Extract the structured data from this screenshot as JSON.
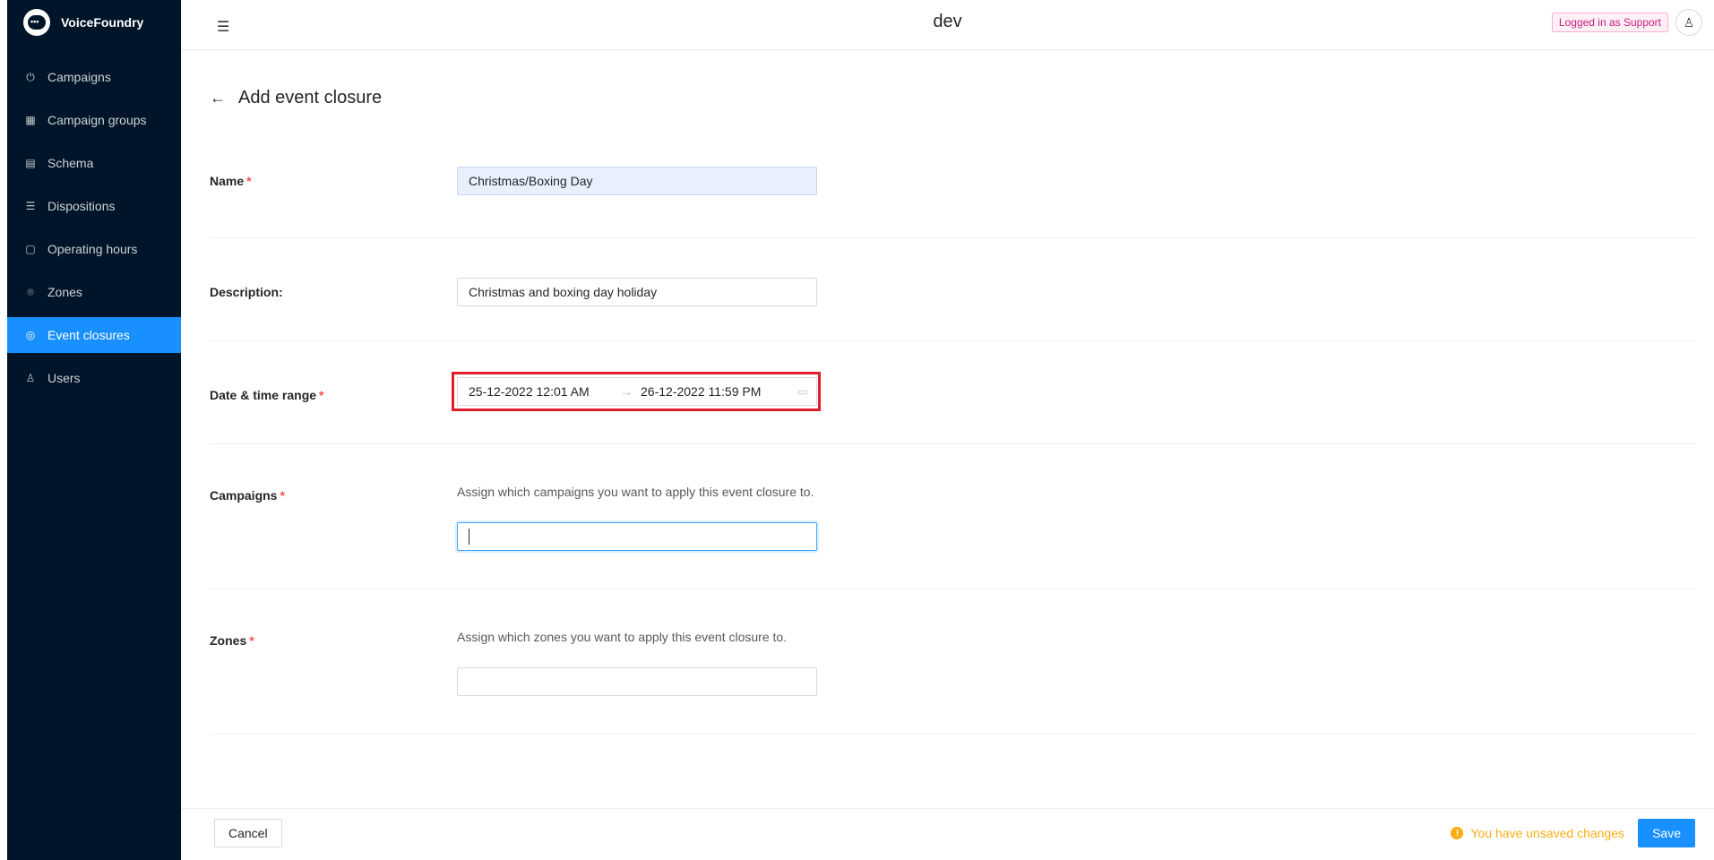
{
  "brand": {
    "name": "VoiceFoundry"
  },
  "sidebar": {
    "items": [
      {
        "label": "Campaigns",
        "icon": "power-icon"
      },
      {
        "label": "Campaign groups",
        "icon": "group-icon"
      },
      {
        "label": "Schema",
        "icon": "table-icon"
      },
      {
        "label": "Dispositions",
        "icon": "list-icon"
      },
      {
        "label": "Operating hours",
        "icon": "calendar-icon"
      },
      {
        "label": "Zones",
        "icon": "location-icon"
      },
      {
        "label": "Event closures",
        "icon": "target-icon",
        "active": true
      },
      {
        "label": "Users",
        "icon": "user-icon"
      }
    ]
  },
  "header": {
    "title": "dev",
    "support_tag": "Logged in as Support"
  },
  "page": {
    "title": "Add event closure"
  },
  "form": {
    "name": {
      "label": "Name",
      "value": "Christmas/Boxing Day"
    },
    "description": {
      "label": "Description",
      "value": "Christmas and boxing day holiday"
    },
    "date_range": {
      "label": "Date & time range",
      "start": "25-12-2022 12:01 AM",
      "end": "26-12-2022 11:59 PM"
    },
    "campaigns": {
      "label": "Campaigns",
      "help": "Assign which campaigns you want to apply this event closure to.",
      "value": ""
    },
    "zones": {
      "label": "Zones",
      "help": "Assign which zones you want to apply this event closure to.",
      "value": ""
    }
  },
  "footer": {
    "cancel_label": "Cancel",
    "unsaved_text": "You have unsaved changes",
    "save_label": "Save"
  },
  "colors": {
    "sidebar_bg": "#001529",
    "accent": "#1890ff",
    "required": "#ff4d4f",
    "highlight_box": "#e11d2a",
    "warning": "#faad14"
  }
}
